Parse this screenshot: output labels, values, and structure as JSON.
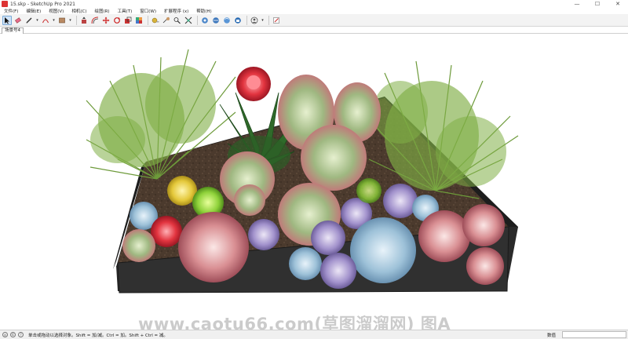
{
  "window": {
    "title": "15.skp - SketchUp Pro 2021",
    "controls": [
      "—",
      "☐",
      "✕"
    ]
  },
  "menu": {
    "items": [
      "文件(F)",
      "编辑(E)",
      "视图(V)",
      "相机(C)",
      "绘图(R)",
      "工具(T)",
      "窗口(W)",
      "扩展程序 (x)",
      "帮助(H)"
    ]
  },
  "toolbar": {
    "tools": [
      {
        "name": "select-tool",
        "icon": "arrow-cursor-icon"
      },
      {
        "name": "eraser-tool",
        "icon": "eraser-icon"
      },
      {
        "name": "line-tool",
        "icon": "pencil-icon"
      },
      {
        "name": "arc-tool",
        "icon": "arc-icon"
      },
      {
        "name": "shape-tool",
        "icon": "rectangle-icon"
      },
      {
        "name": "push-pull-tool",
        "icon": "push-pull-icon"
      },
      {
        "name": "offset-tool",
        "icon": "offset-icon"
      },
      {
        "name": "move-tool",
        "icon": "move-icon"
      },
      {
        "name": "rotate-tool",
        "icon": "rotate-icon"
      },
      {
        "name": "scale-tool",
        "icon": "scale-icon"
      },
      {
        "name": "paint-tool",
        "icon": "paint-bucket-icon"
      },
      {
        "name": "tape-measure-tool",
        "icon": "tape-measure-icon"
      },
      {
        "name": "dimension-tool",
        "icon": "dimension-icon"
      },
      {
        "name": "text-tool",
        "icon": "text-icon"
      },
      {
        "name": "orbit-tool",
        "icon": "orbit-icon"
      },
      {
        "name": "pan-tool",
        "icon": "pan-hand-icon"
      },
      {
        "name": "zoom-tool",
        "icon": "magnifier-icon"
      },
      {
        "name": "zoom-extents-tool",
        "icon": "zoom-extents-icon"
      },
      {
        "name": "warehouse-tool",
        "icon": "3d-warehouse-icon"
      },
      {
        "name": "extension-warehouse-tool",
        "icon": "extension-warehouse-icon"
      },
      {
        "name": "trimble-connect-tool",
        "icon": "connect-icon"
      },
      {
        "name": "extension-manager-tool",
        "icon": "extension-manager-icon"
      },
      {
        "name": "profile-tool",
        "icon": "user-profile-icon"
      },
      {
        "name": "layout-tool",
        "icon": "send-to-layout-icon"
      }
    ]
  },
  "scenes": {
    "active_tab": "场景号4"
  },
  "watermark": {
    "text": "www.caotu66.com(草图溜溜网) 图A"
  },
  "statusbar": {
    "hint": "单击或拖动以选择对象。Shift = 加/减。Ctrl = 加。Shift + Ctrl = 减。",
    "vcb_label": "数值",
    "vcb_value": ""
  },
  "colors": {
    "toolbar_bg": "#f3f3f3",
    "planter_dark": "#2b2b2b",
    "soil": "#4a3a2e",
    "rosemary_green": "#6f9d3c",
    "succulent_pink": "#e8a0a8",
    "succulent_blue": "#9ec4dc",
    "succulent_purple": "#a08fc8"
  }
}
